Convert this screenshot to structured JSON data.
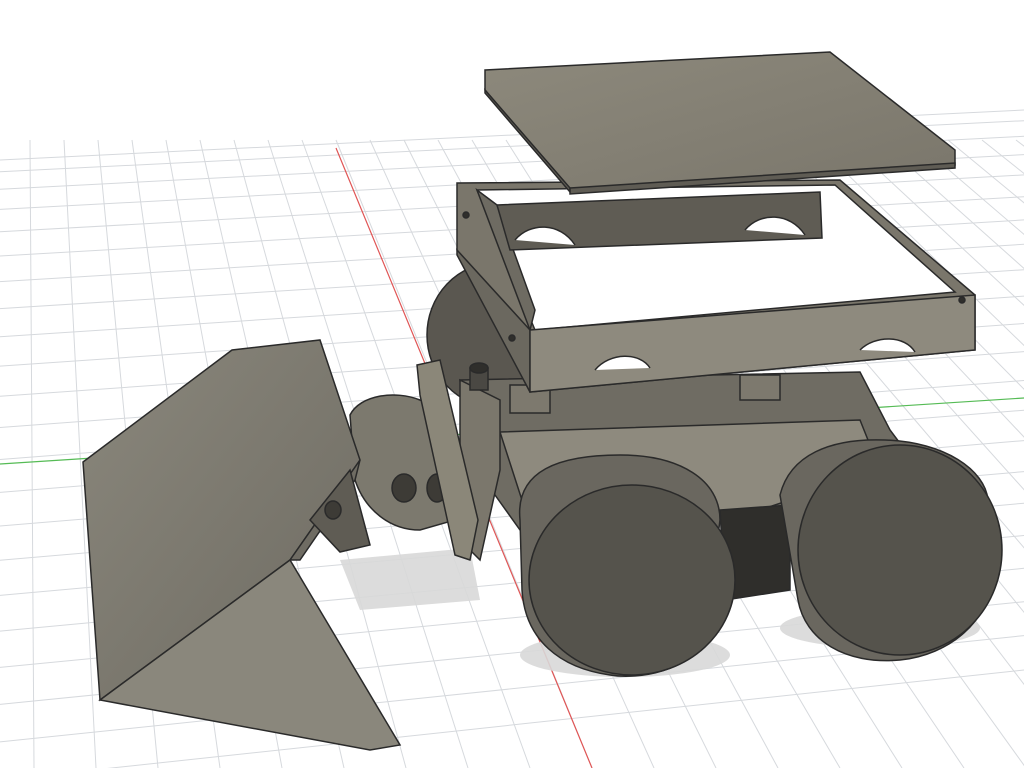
{
  "viewport": {
    "background": "#ffffff",
    "grid_color": "#d6d9dd",
    "x_axis_color": "#e05555",
    "y_axis_color": "#55bb55"
  },
  "model": {
    "body_color": "#8b8779",
    "shade_color": "#5f5c54",
    "dark_color": "#3d3b36",
    "edge_color": "#2a2a2a",
    "parts": [
      "top-lid",
      "chassis-frame",
      "base-chassis",
      "front-wheel-left",
      "front-wheel-right",
      "rear-wheels",
      "arm-bracket",
      "bucket"
    ]
  }
}
